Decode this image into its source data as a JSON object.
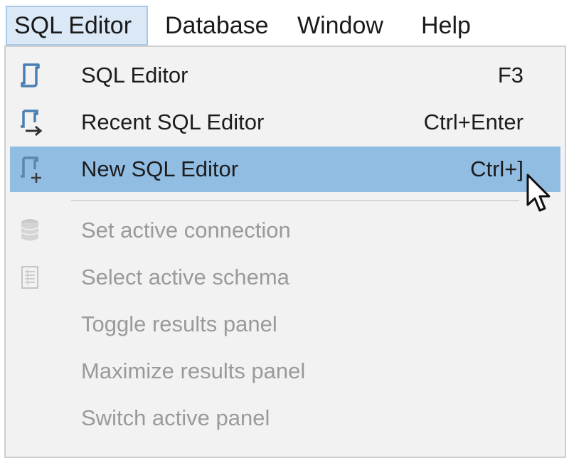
{
  "menubar": {
    "items": [
      {
        "label": "SQL Editor",
        "open": true
      },
      {
        "label": "Database"
      },
      {
        "label": "Window"
      },
      {
        "label": "Help"
      }
    ]
  },
  "dropdown": {
    "items": [
      {
        "label": "SQL Editor",
        "shortcut": "F3",
        "icon": "sql-editor-icon",
        "enabled": true
      },
      {
        "label": "Recent SQL Editor",
        "shortcut": "Ctrl+Enter",
        "icon": "recent-sql-editor-icon",
        "enabled": true
      },
      {
        "label": "New SQL Editor",
        "shortcut": "Ctrl+]",
        "icon": "new-sql-editor-icon",
        "enabled": true,
        "highlighted": true
      },
      {
        "label": "Set active connection",
        "shortcut": "",
        "icon": "database-icon",
        "enabled": false
      },
      {
        "label": "Select active schema",
        "shortcut": "",
        "icon": "schema-icon",
        "enabled": false
      },
      {
        "label": "Toggle results panel",
        "shortcut": "",
        "icon": "",
        "enabled": false
      },
      {
        "label": "Maximize results panel",
        "shortcut": "",
        "icon": "",
        "enabled": false
      },
      {
        "label": "Switch active panel",
        "shortcut": "",
        "icon": "",
        "enabled": false
      }
    ]
  },
  "colors": {
    "highlight": "#91bde3",
    "menubar_open_bg": "#dbe9f7",
    "menu_bg": "#f2f2f2",
    "disabled_text": "#9a9a9a",
    "icon_blue": "#4a7fb3"
  }
}
